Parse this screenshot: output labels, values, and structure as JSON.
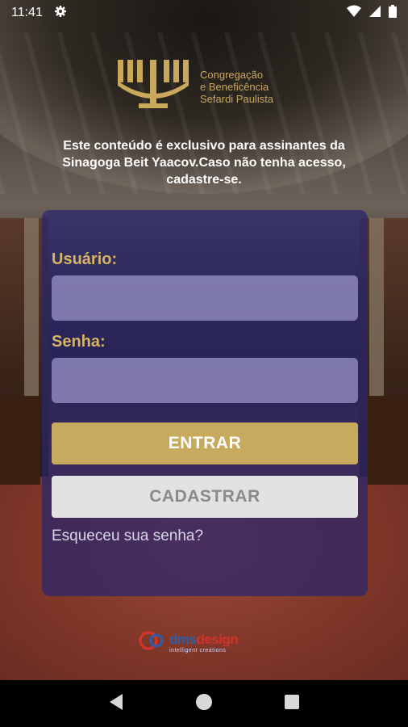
{
  "status_bar": {
    "time": "11:41",
    "icons": [
      "gear-icon",
      "wifi-icon",
      "cell-signal-icon",
      "battery-icon"
    ]
  },
  "brand": {
    "line1": "Congregação",
    "line2": "e Beneficência",
    "line3": "Sefardi Paulista",
    "logo_icon": "menorah-icon",
    "color": "#c9a85c"
  },
  "notice": {
    "line1": "Este conteúdo é exclusivo para assinantes da",
    "line2": "Sinagoga Beit Yaacov.Caso não tenha acesso,",
    "line3": "cadastre-se."
  },
  "form": {
    "user_label": "Usuário:",
    "user_value": "",
    "password_label": "Senha:",
    "password_value": "",
    "enter_label": "ENTRAR",
    "register_label": "CADASTRAR",
    "forgot_label": "Esqueceu sua senha?"
  },
  "footer": {
    "brand_main_a": "dms",
    "brand_main_b": "design",
    "tagline": "intelligent creations"
  },
  "nav": {
    "icons": [
      "back-icon",
      "home-icon",
      "recents-icon"
    ]
  },
  "colors": {
    "gold": "#c8aa5e",
    "card": "#28266e",
    "input": "#aaa5dc"
  }
}
